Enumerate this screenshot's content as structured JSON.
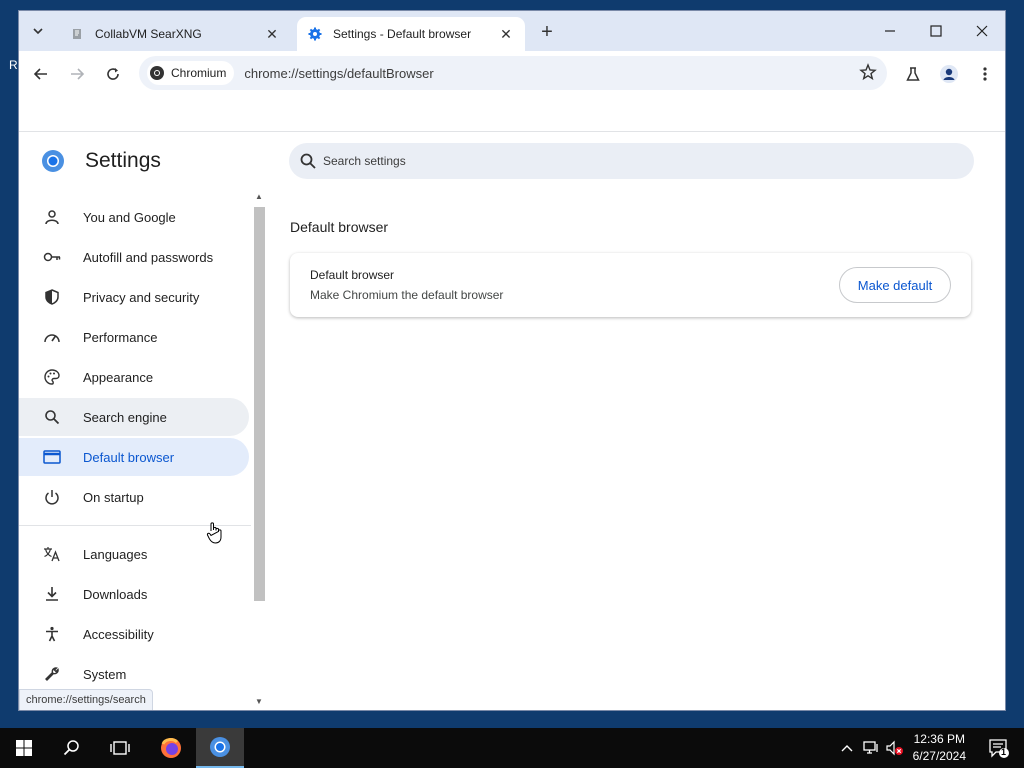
{
  "tabs": [
    {
      "label": "CollabVM SearXNG",
      "active": false
    },
    {
      "label": "Settings - Default browser",
      "active": true
    }
  ],
  "toolbar": {
    "chip_label": "Chromium",
    "url": "chrome://settings/defaultBrowser"
  },
  "settings": {
    "title": "Settings",
    "search_placeholder": "Search settings"
  },
  "sidebar": {
    "items": [
      {
        "label": "You and Google",
        "icon": "person-icon"
      },
      {
        "label": "Autofill and passwords",
        "icon": "key-icon"
      },
      {
        "label": "Privacy and security",
        "icon": "shield-icon"
      },
      {
        "label": "Performance",
        "icon": "speedometer-icon"
      },
      {
        "label": "Appearance",
        "icon": "palette-icon"
      },
      {
        "label": "Search engine",
        "icon": "search-icon"
      },
      {
        "label": "Default browser",
        "icon": "browser-window-icon"
      },
      {
        "label": "On startup",
        "icon": "power-icon"
      },
      {
        "label": "Languages",
        "icon": "translate-icon"
      },
      {
        "label": "Downloads",
        "icon": "download-icon"
      },
      {
        "label": "Accessibility",
        "icon": "accessibility-icon"
      },
      {
        "label": "System",
        "icon": "wrench-icon"
      }
    ],
    "hovered": "Search engine",
    "selected": "Default browser"
  },
  "status_tooltip": "chrome://settings/search",
  "main": {
    "section_title": "Default browser",
    "card_title": "Default browser",
    "card_subtitle": "Make Chromium the default browser",
    "make_default_label": "Make default"
  },
  "taskbar": {
    "time": "12:36 PM",
    "date": "6/27/2024",
    "notification_count": "1"
  },
  "colors": {
    "accent": "#0b57d0",
    "selected_bg": "#e3ecfb",
    "tabstrip_bg": "#dfe7f5",
    "desktop_bg": "#0f3b6e"
  }
}
